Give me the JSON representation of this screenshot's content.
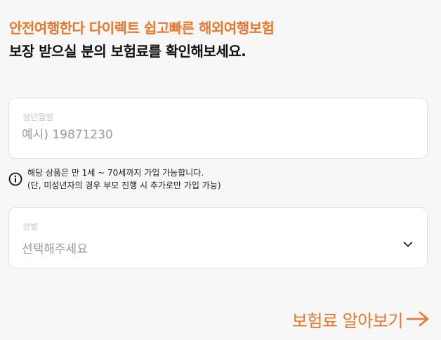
{
  "header": {
    "accent_line": "안전여행한다 다이렉트 쉽고빠른 해외여행보험",
    "main_line": "보장 받으실 분의 보험료를 확인해보세요."
  },
  "birth_field": {
    "label": "생년월일",
    "value": "",
    "placeholder": "예시) 19871230"
  },
  "notice": {
    "icon": "info-icon",
    "line1": "해당 상품은 만 1세 ~ 70세까지 가입 가능합니다.",
    "line2": "(단, 미성년자의 경우 부모 진행 시 추가로만 가입 가능)"
  },
  "gender_field": {
    "label": "성별",
    "selected": "선택해주세요",
    "icon": "chevron-down-icon"
  },
  "cta": {
    "label": "보험료 알아보기",
    "icon": "arrow-right-icon"
  },
  "colors": {
    "accent": "#e8772e",
    "background": "#f7f7f7",
    "text": "#111111"
  }
}
